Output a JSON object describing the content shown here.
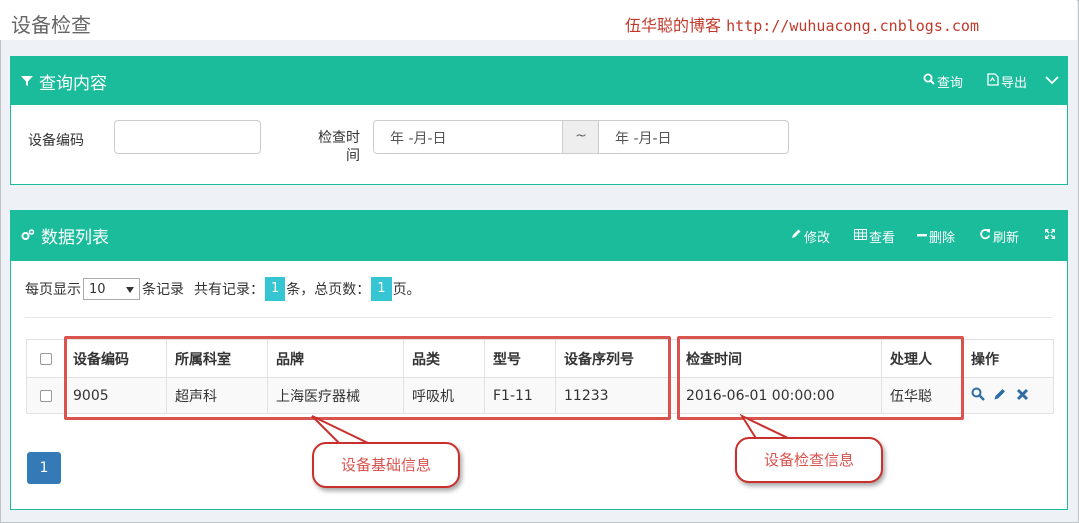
{
  "page": {
    "title": "设备检查",
    "blog_prefix": "伍华聪的博客",
    "blog_url": "http://wuhuacong.cnblogs.com"
  },
  "query_panel": {
    "title": "查询内容",
    "tools": {
      "search": "查询",
      "export": "导出"
    },
    "fields": {
      "device_code_label": "设备编码",
      "device_code_value": "",
      "check_time_label_line1": "检查时",
      "check_time_label_line2": "间",
      "date_from": "年 -月-日",
      "range_sep": "~",
      "date_to": "年 -月-日"
    }
  },
  "data_panel": {
    "title": "数据列表",
    "tools": {
      "edit": "修改",
      "view": "查看",
      "delete": "删除",
      "refresh": "刷新"
    },
    "pager": {
      "per_page_prefix": "每页显示",
      "per_page_value": "10",
      "per_page_suffix": "条记录",
      "total_prefix": "共有记录：",
      "total_records": "1",
      "total_pages_prefix": "条，总页数：",
      "total_pages": "1",
      "total_pages_suffix": "页。"
    },
    "columns": [
      "设备编码",
      "所属科室",
      "品牌",
      "品类",
      "型号",
      "设备序列号",
      "检查时间",
      "处理人",
      "操作"
    ],
    "rows": [
      {
        "code": "9005",
        "dept": "超声科",
        "brand": "上海医疗器械",
        "category": "呼吸机",
        "model": "F1-11",
        "serial": "11233",
        "check_time": "2016-06-01 00:00:00",
        "handler": "伍华聪"
      }
    ],
    "current_page": "1"
  },
  "annotations": {
    "base_info": "设备基础信息",
    "check_info": "设备检查信息"
  },
  "colors": {
    "header_teal": "#1abc9c",
    "badge_cyan": "#36c6d3",
    "pager_blue": "#337ab7",
    "annotation_red": "#d9534f",
    "action_blue": "#2e6da4"
  }
}
